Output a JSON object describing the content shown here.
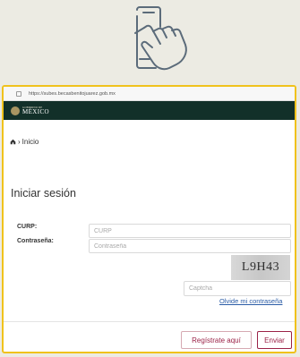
{
  "browser": {
    "url": "https://subes.becasbenitojuarez.gob.mx"
  },
  "header": {
    "gov_small": "GOBIERNO DE",
    "gov_big": "MÉXICO"
  },
  "breadcrumb": {
    "sep": "›",
    "label": "Inicio"
  },
  "page": {
    "title": "Iniciar sesión"
  },
  "form": {
    "curp_label": "CURP:",
    "curp_placeholder": "CURP",
    "password_label": "Contraseña:",
    "password_placeholder": "Contraseña",
    "captcha_code": "L9H43",
    "captcha_placeholder": "Captcha",
    "forgot_link": "Olvide mi contraseña"
  },
  "actions": {
    "register": "Regístrate aquí",
    "submit": "Enviar"
  },
  "colors": {
    "accent": "#9b2247",
    "header_bg": "#123029",
    "frame_border": "#f0c21c",
    "icon": "#5b6b7a"
  }
}
